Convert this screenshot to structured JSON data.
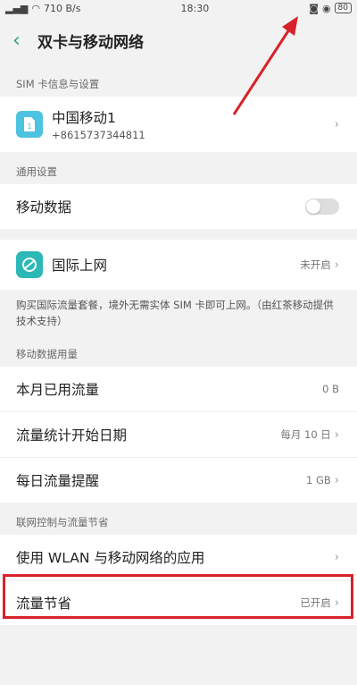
{
  "status": {
    "speed": "710 B/s",
    "time": "18:30",
    "battery": "80"
  },
  "header": {
    "title": "双卡与移动网络"
  },
  "sections": {
    "sim": "SIM 卡信息与设置",
    "general": "通用设置",
    "usage": "移动数据用量",
    "control": "联网控制与流量节省"
  },
  "sim": {
    "name": "中国移动1",
    "number": "+8615737344811"
  },
  "general": {
    "mobile_data": "移动数据"
  },
  "intl": {
    "label": "国际上网",
    "status": "未开启"
  },
  "note": "购买国际流量套餐，境外无需实体 SIM 卡即可上网。（由红茶移动提供技术支持）",
  "usage": {
    "rows": [
      {
        "label": "本月已用流量",
        "value": "0 B"
      },
      {
        "label": "流量统计开始日期",
        "value": "每月 10 日"
      },
      {
        "label": "每日流量提醒",
        "value": "1 GB"
      }
    ]
  },
  "control": {
    "wlan_apps": "使用 WLAN 与移动网络的应用",
    "saver": {
      "label": "流量节省",
      "value": "已开启"
    }
  },
  "colors": {
    "accent": "#2aa58a",
    "highlight": "#d8222a"
  }
}
